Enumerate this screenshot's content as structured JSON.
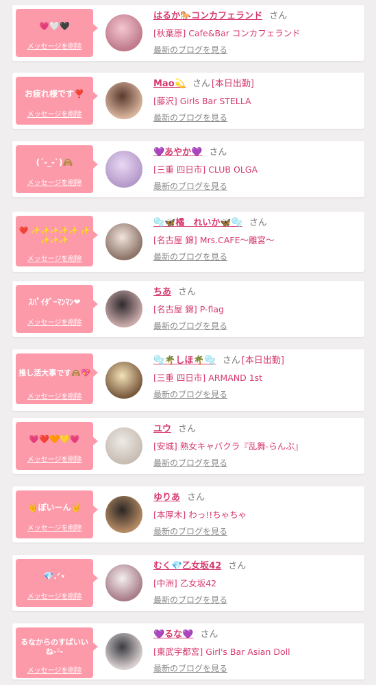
{
  "colors": {
    "accent": "#d63a6f",
    "bubble": "#fd9aaa",
    "background": "#f1eef0"
  },
  "delete_label": "メッセージを削除",
  "san_label": "さん",
  "blog_label": "最新のブログを見る",
  "entries": [
    {
      "message": "💗🤍🖤",
      "name": "はるか🐎コンカフェランド",
      "badge": "",
      "shop": "[秋葉原] Cafe&Bar コンカフェランド"
    },
    {
      "message": "お疲れ様です❣️",
      "name": "Mao💫",
      "badge": "[本日出勤]",
      "shop": "[藤沢] Girls Bar STELLA"
    },
    {
      "message": "(´-_-`)🙈",
      "name": "💜あやか💜",
      "badge": "",
      "shop": "[三重 四日市] CLUB OLGA"
    },
    {
      "message": "❤️ ✨✨✨✨✨ ✨✨✨✨",
      "name": "🫧🦋橘　れいか🦋🫧",
      "badge": "",
      "shop": "[名古屋 錦] Mrs.CAFE〜離宮〜"
    },
    {
      "message": "ｽﾊﾟｲﾀﾞｰﾏﾝﾏﾝ❤︎",
      "name": "ちあ",
      "badge": "",
      "shop": "[名古屋 錦] P-flag"
    },
    {
      "message": "推し活大事です🙈💖",
      "name": "🫧🌴しほ🌴🫧",
      "badge": "[本日出勤]",
      "shop": "[三重 四日市] ARMAND 1st"
    },
    {
      "message": "💗❤️🧡💛💗",
      "name": "ユウ",
      "badge": "",
      "shop": "[安城] 熟女キャバクラ『乱舞-らんぶ』"
    },
    {
      "message": "🤘ぽいーん🤘",
      "name": "ゆりあ",
      "badge": "",
      "shop": "[本厚木] わっ!!ちゃちゃ"
    },
    {
      "message": "💎.ᐟ‪‪⋆",
      "name": "むく💎乙女坂42",
      "badge": "",
      "shop": "[中洲] 乙女坂42"
    },
    {
      "message": "るなからのすぱいいね-ᵕ̈-",
      "name": "💜るな💜",
      "badge": "",
      "shop": "[東武宇都宮] Girl's Bar Asian Doll"
    }
  ]
}
